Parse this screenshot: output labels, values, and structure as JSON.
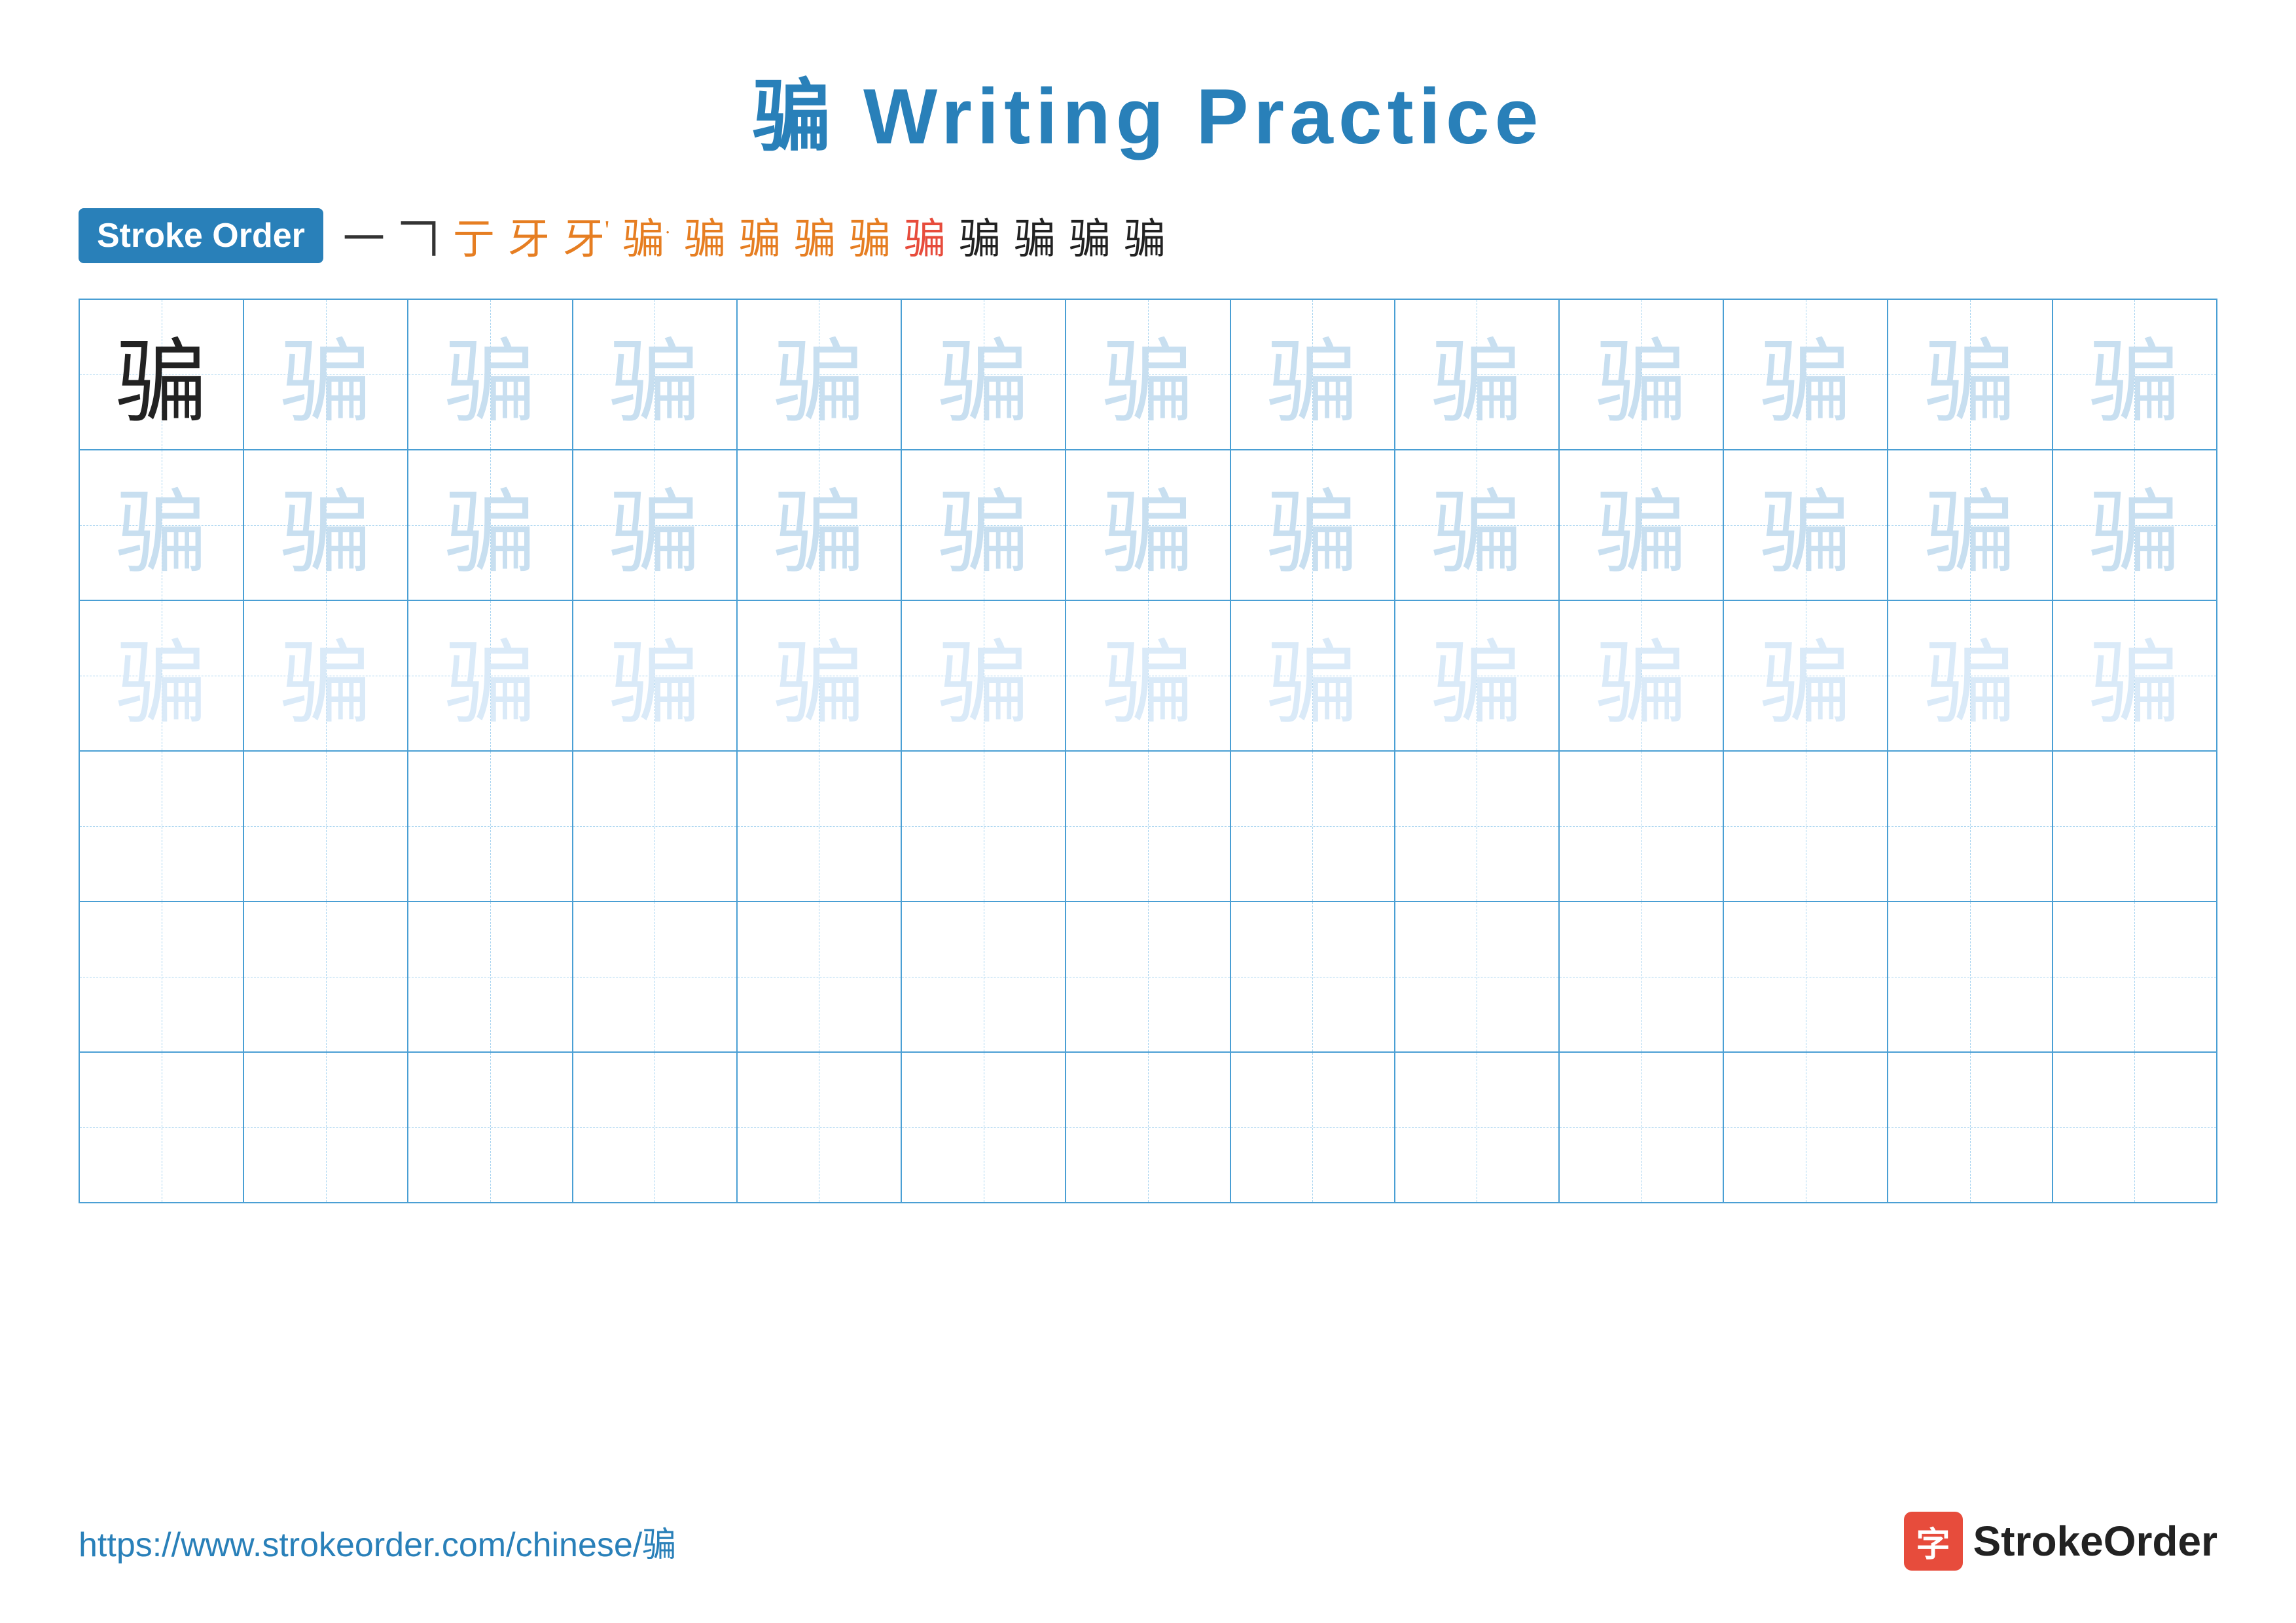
{
  "title": {
    "text": "骗 Writing Practice",
    "char": "骗"
  },
  "stroke_order": {
    "badge_label": "Stroke Order",
    "strokes": [
      "一",
      "𠃍",
      "亍",
      "牙",
      "牙'",
      "骗̈",
      "骗̈",
      "骗̈",
      "骗̈",
      "骗̄",
      "骗",
      "骗",
      "骗",
      "骗",
      "骗"
    ]
  },
  "grid": {
    "character": "骗",
    "rows": 6,
    "cols": 13
  },
  "footer": {
    "url": "https://www.strokeorder.com/chinese/骗",
    "brand_icon": "字",
    "brand_name": "StrokeOrder"
  }
}
